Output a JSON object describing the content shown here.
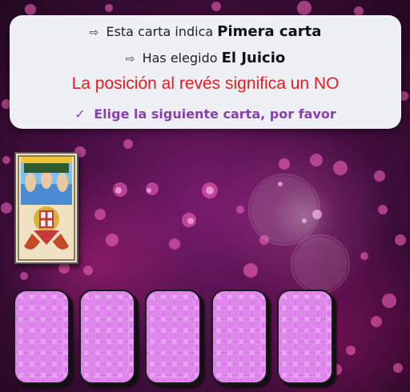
{
  "panel": {
    "line1_prefix": "Esta carta indica",
    "line1_value": "Pimera carta",
    "line2_prefix": "Has elegido",
    "line2_value": "El Juicio",
    "warning": "La posición al revés significa un NO",
    "instruction": "Elige la siguiente carta, por favor",
    "arrow_glyph": "⇨",
    "check_glyph": "✓"
  },
  "chosen_card": {
    "name": "El Juicio",
    "orientation": "reversed"
  },
  "deck": {
    "count": 5,
    "back_color": "#d86ee8"
  },
  "colors": {
    "warning": "#e42020",
    "instruction": "#8b3fb3",
    "panel_bg": "#eef0f5"
  }
}
